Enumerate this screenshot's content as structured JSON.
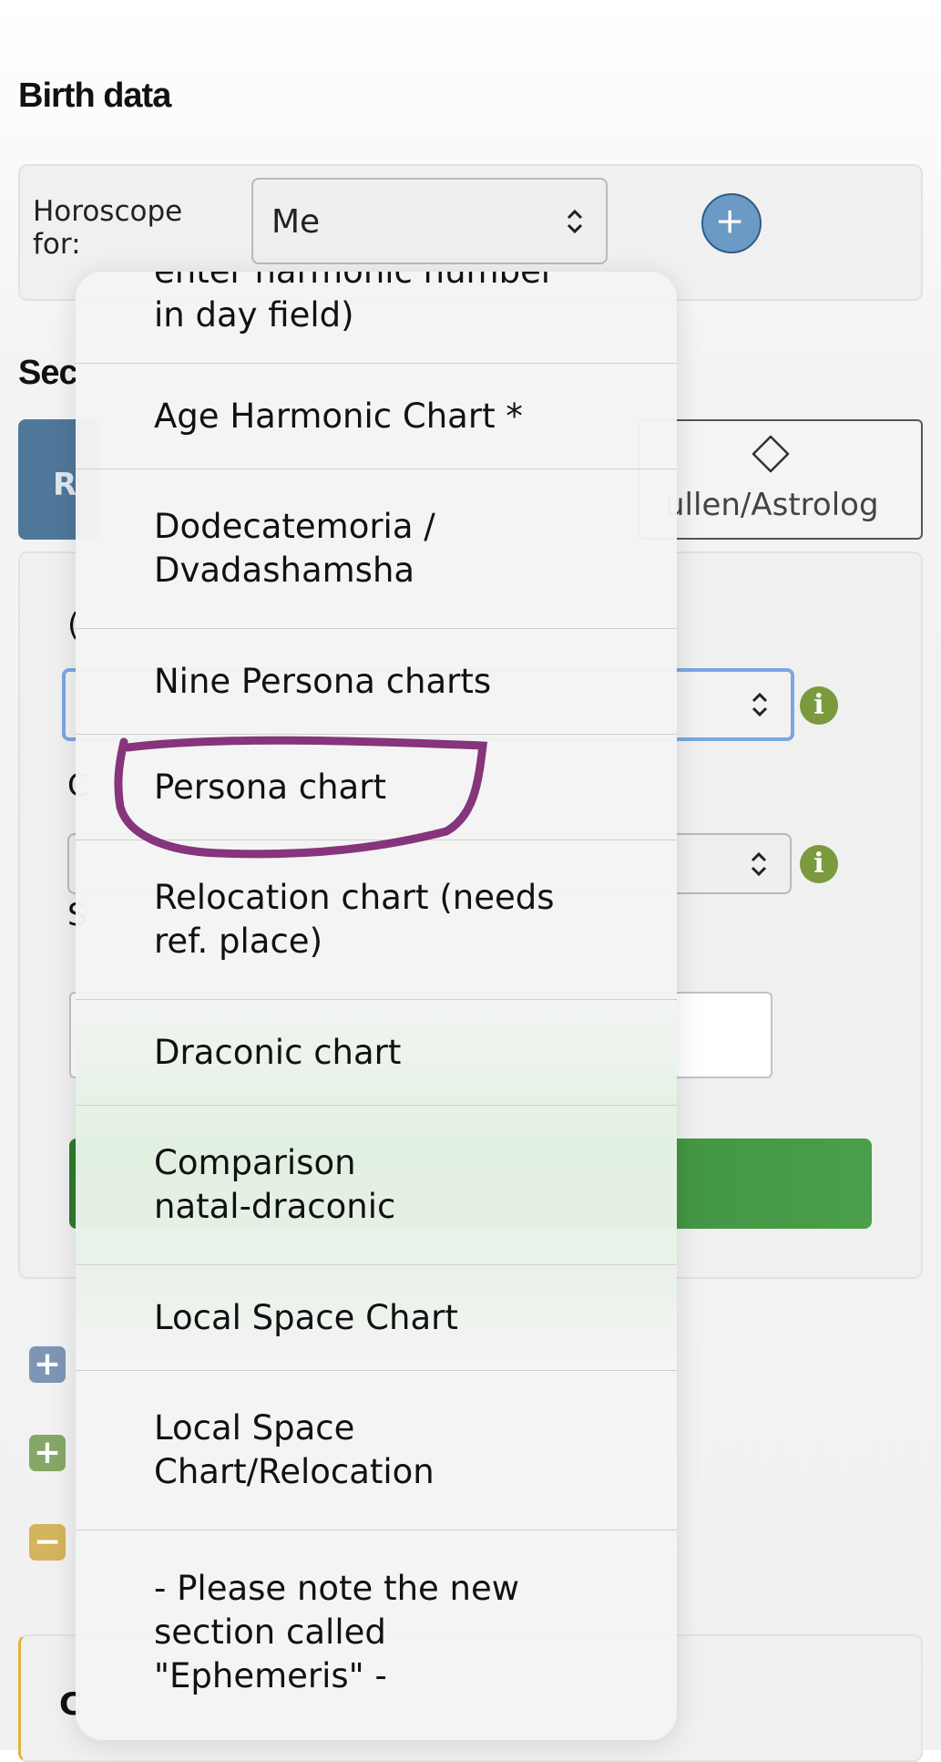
{
  "page": {
    "heading": "Birth data",
    "section_heading_partial": "Sec"
  },
  "horoscope": {
    "label": "Horoscope for:",
    "selected": "Me",
    "add_icon": "plus-circle-icon"
  },
  "mode_buttons": {
    "left_partial": "R",
    "right_partial": "ullen/Astrolog",
    "right_icon": "diamond-icon"
  },
  "form": {
    "label1_partial": "(",
    "label2_partial": "C",
    "label3_partial": "S",
    "bottom_partial": "C"
  },
  "side_icons": [
    "plus-square-icon",
    "plus-square-icon",
    "minus-square-icon"
  ],
  "colors": {
    "accent_blue": "#4f7799",
    "green": "#3d8b3d",
    "info": "#7a9a3d",
    "annotation": "#7a1f6e"
  },
  "dropdown": {
    "items": [
      {
        "label": "enter harmonic number in day field)"
      },
      {
        "label": "Age Harmonic Chart *"
      },
      {
        "label": "Dodecatemoria / Dvadashamsha"
      },
      {
        "label": "Nine Persona charts"
      },
      {
        "label": "Persona chart",
        "annotated": true
      },
      {
        "label": "Relocation chart (needs ref. place)"
      },
      {
        "label": "Draconic chart"
      },
      {
        "label": "Comparison natal-draconic"
      },
      {
        "label": "Local Space Chart"
      },
      {
        "label": "Local Space Chart/Relocation"
      },
      {
        "label": "- Please note the new section called \"Ephemeris\" -"
      }
    ]
  }
}
